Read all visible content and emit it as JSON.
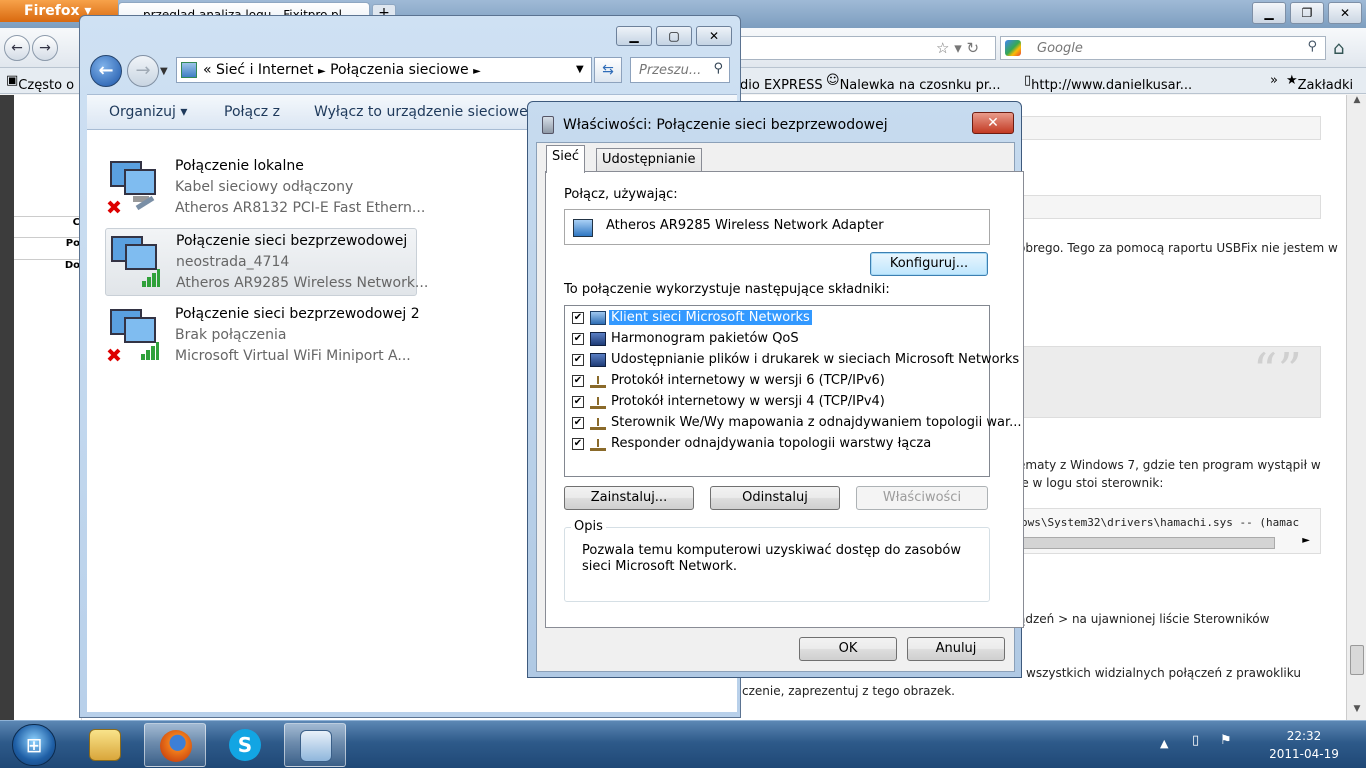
{
  "firefox": {
    "menu_button": "Firefox",
    "tab_title": "przegląd analiza logu - Fixitpro.pl",
    "new_tab": "+",
    "search_placeholder": "Google",
    "bookmarks": [
      "Często o",
      "dio EXPRESS",
      "Nalewka na czosnku pr...",
      "http://www.danielkusar...",
      "»",
      "Zakładki"
    ],
    "left_labels": [
      "C",
      "Po",
      "Do"
    ],
    "page_texts": [
      "obrego. Tego za pomocą raportu USBFix nie jestem w",
      "ematy z Windows 7, gdzie ten program wystąpił w",
      "le w logu stoi sterownik:",
      "ows\\System32\\drivers\\hamachi.sys -- (hamac",
      "ądzeń > na ujawnionej liście Sterowników",
      "wszystkich widzialnych połączeń z prawokliku",
      "czenie, zaprezentuj z tego obrazek."
    ],
    "quote_mark": "“”"
  },
  "explorer": {
    "address": {
      "prefix": "«",
      "crumb1": "Sieć i Internet",
      "sep": "►",
      "crumb2": "Połączenia sieciowe"
    },
    "search_placeholder": "Przeszu...",
    "commands": [
      "Organizuj ▾",
      "Połącz z",
      "Wyłącz to urządzenie sieciowe"
    ],
    "connections": [
      {
        "name": "Połączenie lokalne",
        "status": "Kabel sieciowy odłączony",
        "device": "Atheros AR8132 PCI-E Fast Ethern..."
      },
      {
        "name": "Połączenie sieci bezprzewodowej",
        "status": "neostrada_4714",
        "device": "Atheros AR9285 Wireless Network..."
      },
      {
        "name": "Połączenie sieci bezprzewodowej 2",
        "status": "Brak połączenia",
        "device": "Microsoft Virtual WiFi Miniport A..."
      }
    ]
  },
  "dialog": {
    "title": "Właściwości: Połączenie sieci bezprzewodowej",
    "tabs": [
      "Sieć",
      "Udostępnianie"
    ],
    "connect_using_label": "Połącz, używając:",
    "adapter": "Atheros AR9285 Wireless Network Adapter",
    "configure_button": "Konfiguruj...",
    "components_label": "To połączenie wykorzystuje następujące składniki:",
    "components": [
      {
        "label": "Klient sieci Microsoft Networks",
        "checked": "✔",
        "icon": "network-client-icon"
      },
      {
        "label": "Harmonogram pakietów QoS",
        "checked": "✔",
        "icon": "scheduler-icon"
      },
      {
        "label": "Udostępnianie plików i drukarek w sieciach Microsoft Networks",
        "checked": "✔",
        "icon": "file-sharing-icon"
      },
      {
        "label": "Protokół internetowy w wersji 6 (TCP/IPv6)",
        "checked": "✔",
        "icon": "protocol-icon"
      },
      {
        "label": "Protokół internetowy w wersji 4 (TCP/IPv4)",
        "checked": "✔",
        "icon": "protocol-icon"
      },
      {
        "label": "Sterownik We/Wy mapowania z odnajdywaniem topologii war...",
        "checked": "✔",
        "icon": "protocol-icon"
      },
      {
        "label": "Responder odnajdywania topologii warstwy łącza",
        "checked": "✔",
        "icon": "protocol-icon"
      }
    ],
    "install_button": "Zainstaluj...",
    "uninstall_button": "Odinstaluj",
    "properties_button": "Właściwości",
    "description_legend": "Opis",
    "description": "Pozwala temu komputerowi uzyskiwać dostęp do zasobów sieci Microsoft Network.",
    "ok_button": "OK",
    "cancel_button": "Anuluj"
  },
  "taskbar": {
    "time": "22:32",
    "date": "2011-04-19"
  }
}
